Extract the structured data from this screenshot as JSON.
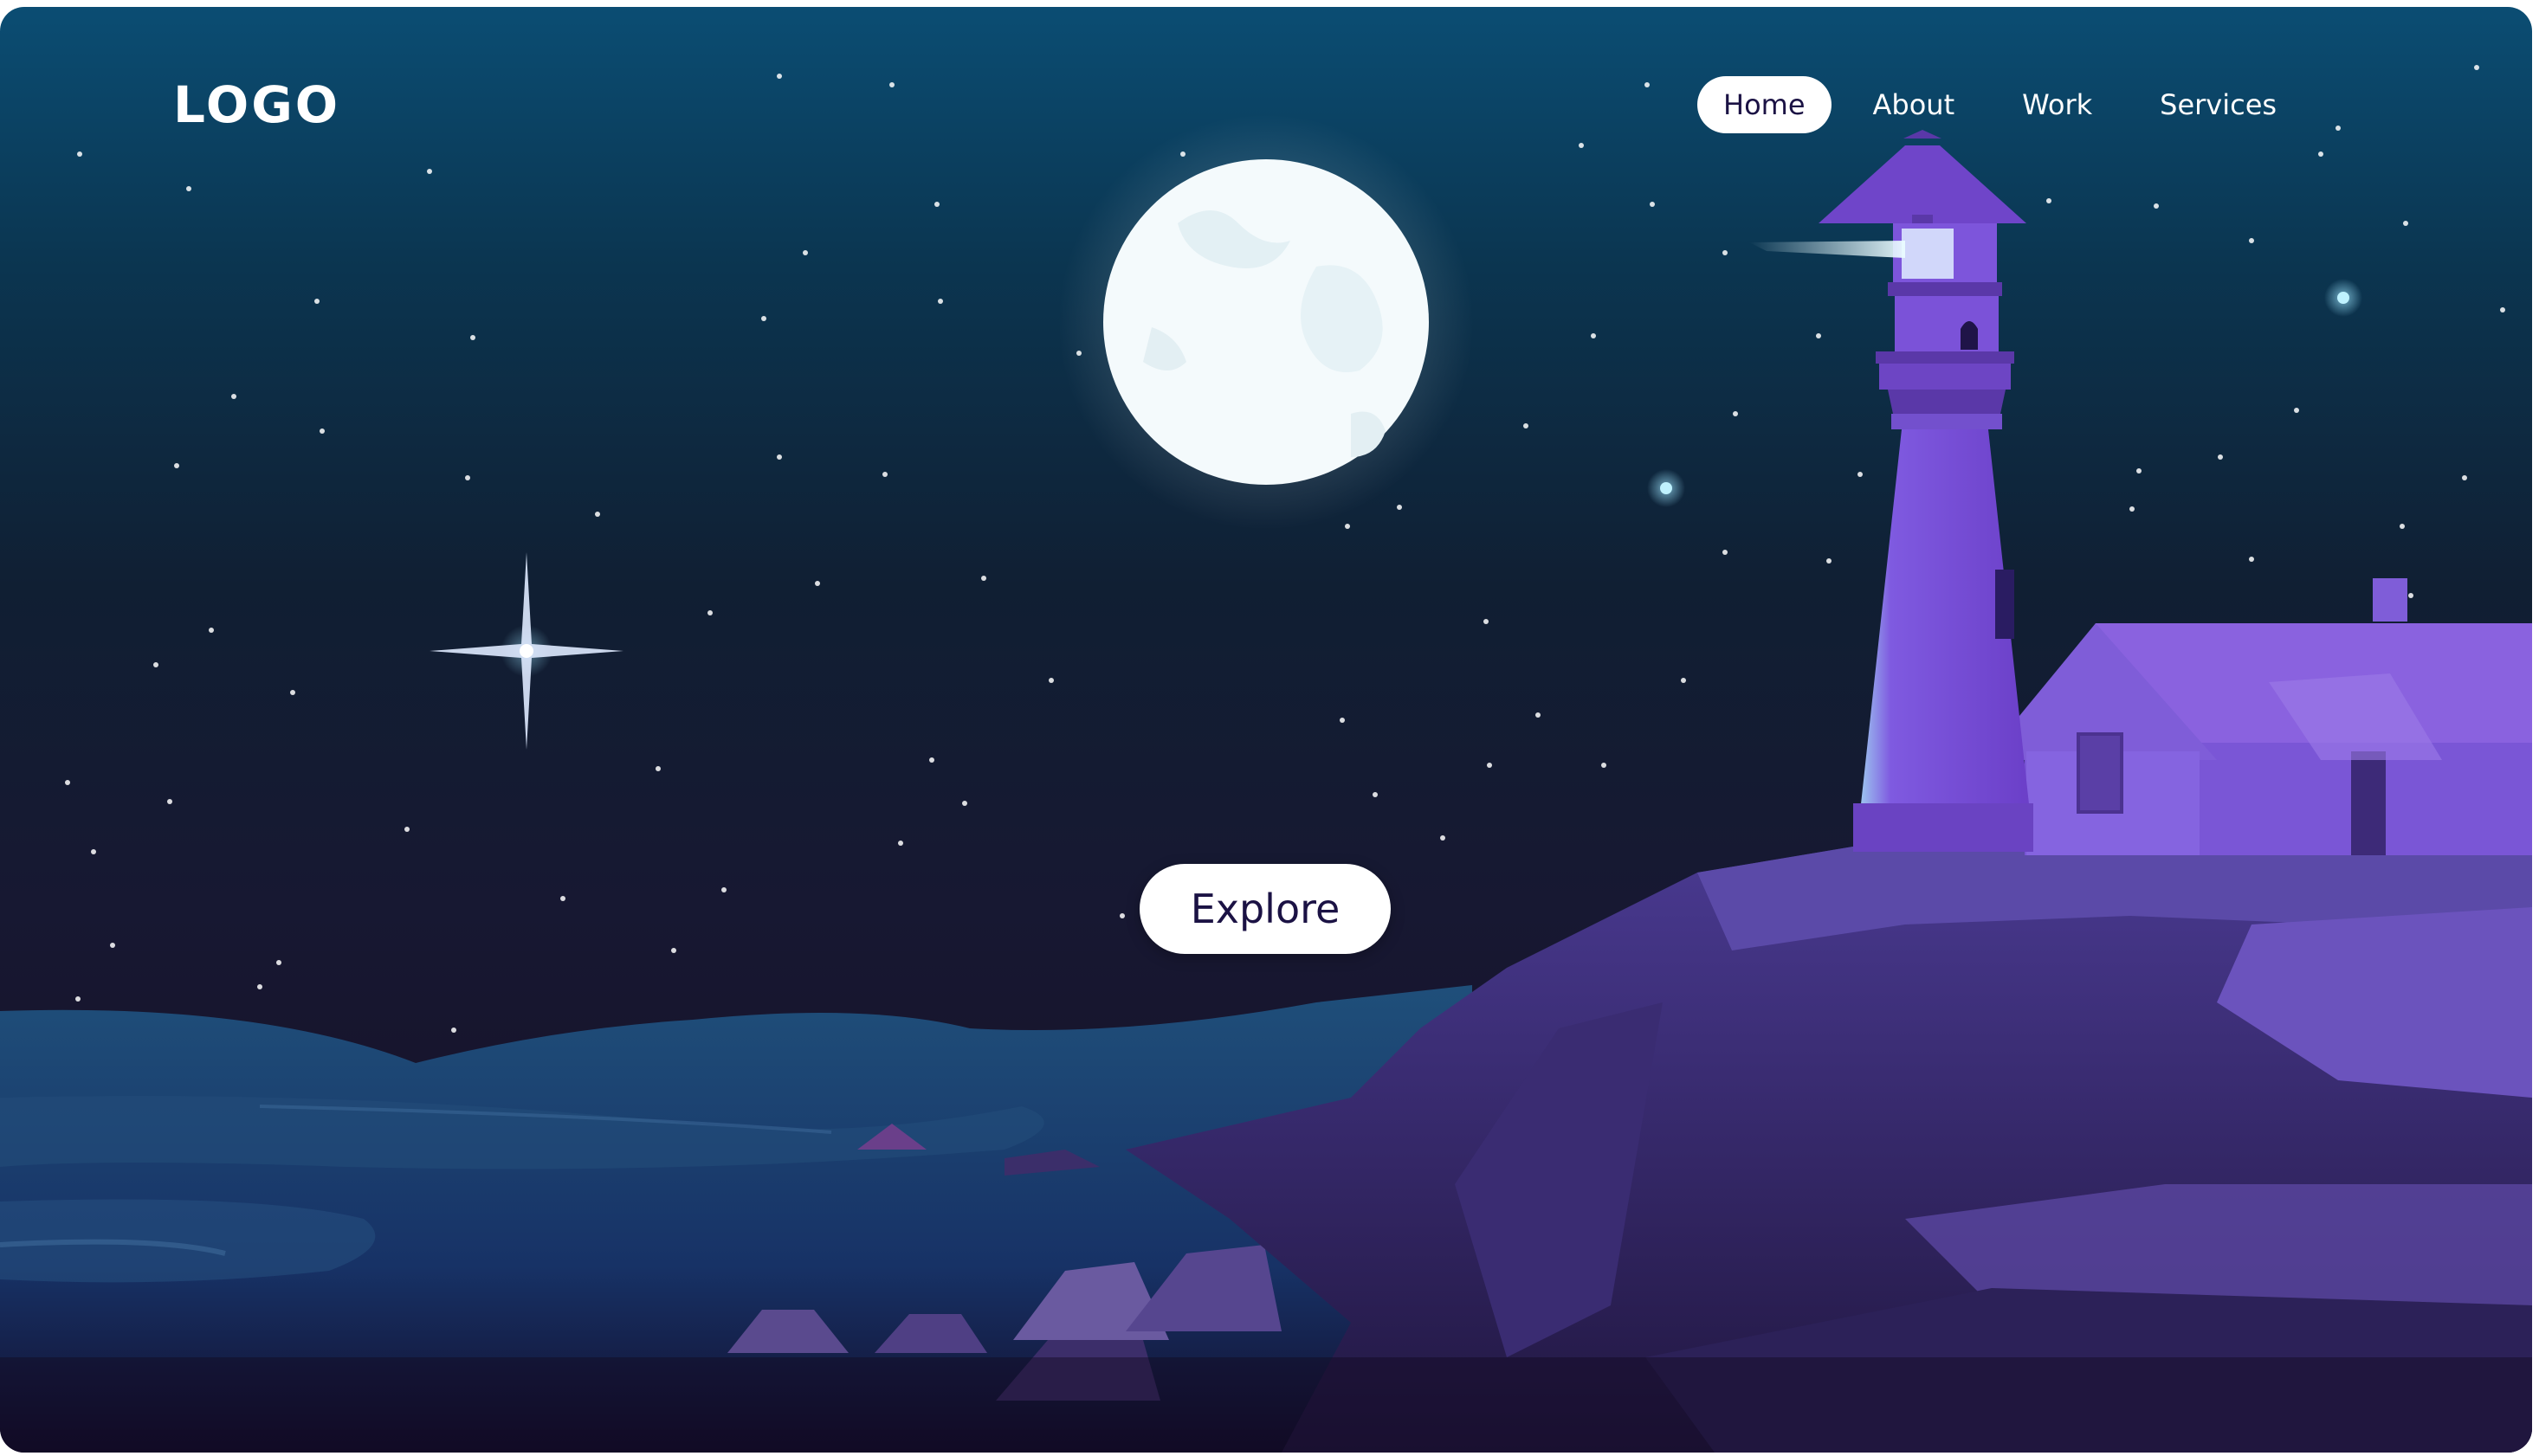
{
  "header": {
    "logo": "LOGO",
    "nav": [
      {
        "label": "Home",
        "active": true
      },
      {
        "label": "About",
        "active": false
      },
      {
        "label": "Work",
        "active": false
      },
      {
        "label": "Services",
        "active": false
      }
    ]
  },
  "hero": {
    "cta_label": "Explore"
  },
  "colors": {
    "sky_top": "#0b4d73",
    "sky_bottom": "#170d22",
    "lighthouse": "#7b4fd9",
    "cliff": "#3a2b6e",
    "sea": "#1b3d6e",
    "moon": "#f4fafc",
    "button_text": "#1b1244"
  },
  "icons": {
    "moon": "moon-illustration",
    "star": "sparkle-star-icon",
    "lighthouse": "lighthouse-illustration"
  }
}
